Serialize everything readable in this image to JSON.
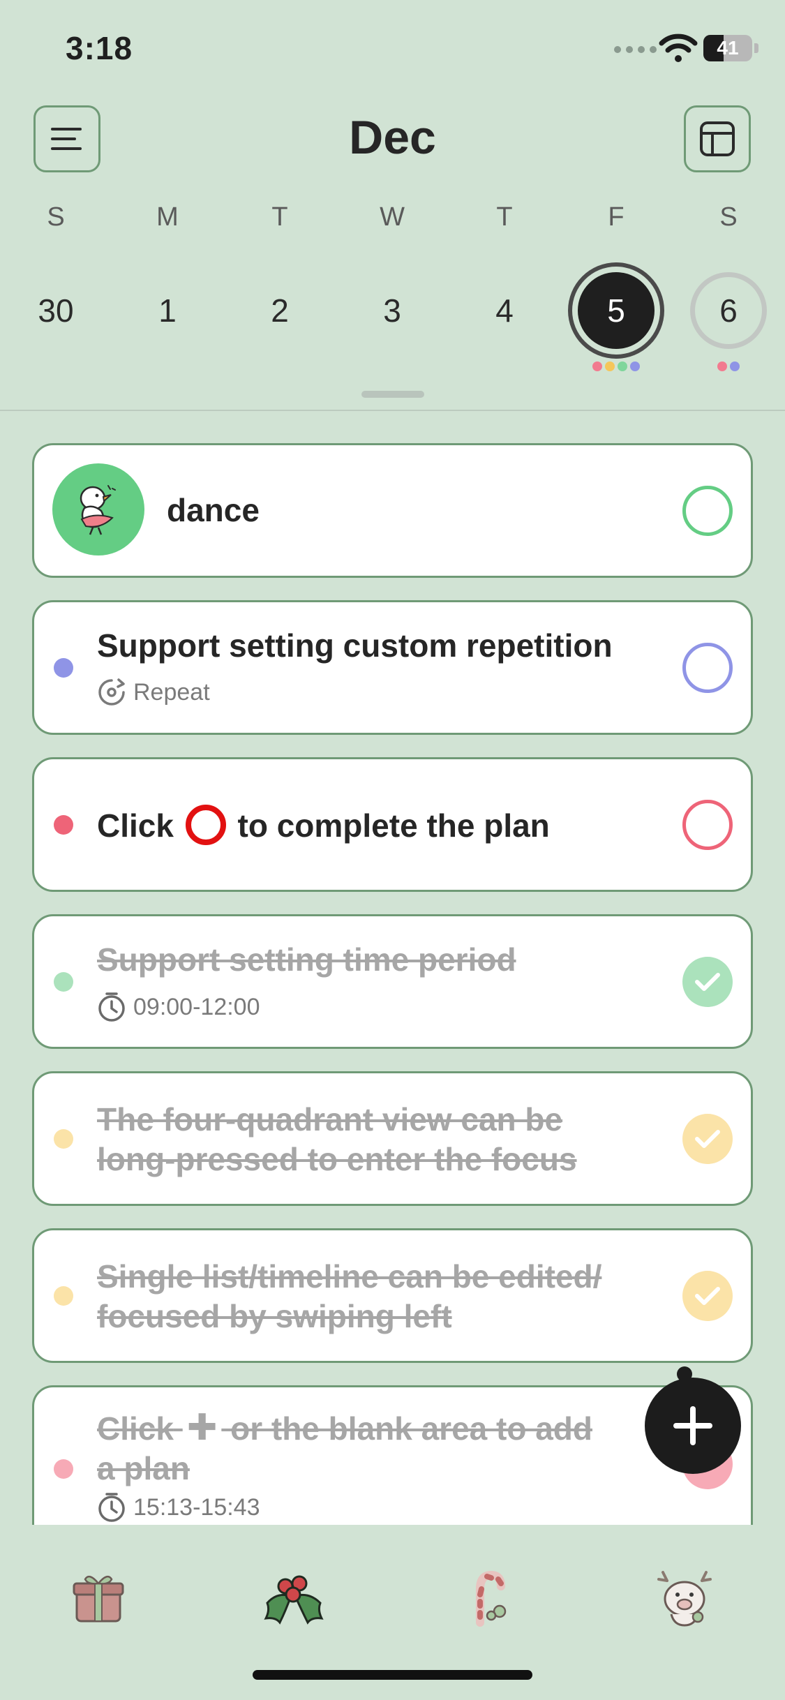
{
  "status_bar": {
    "time": "3:18",
    "battery_percent": "41",
    "battery_level": 0.41
  },
  "header": {
    "month": "Dec",
    "menu_icon": "hamburger-menu-icon",
    "layout_icon": "layout-grid-icon"
  },
  "week": {
    "weekdays": [
      "S",
      "M",
      "T",
      "W",
      "T",
      "F",
      "S"
    ],
    "dates": [
      "30",
      "1",
      "2",
      "3",
      "4",
      "5",
      "6"
    ],
    "today_index": 5,
    "friday_dots": [
      "#f27b8f",
      "#f5c65a",
      "#7fd69b",
      "#8f94e6"
    ],
    "saturday_dots": [
      "#f27b8f",
      "#8f94e6"
    ]
  },
  "tasks": [
    {
      "title": "dance",
      "completed": false,
      "color": "#64cd84",
      "avatar": "duck-dancing-sticker"
    },
    {
      "title": "Support setting custom repetition",
      "subtitle": "Repeat",
      "sub_icon": "repeat-icon",
      "completed": false,
      "color": "#8f94e6"
    },
    {
      "title_before": "Click",
      "title_after": "to complete the plan",
      "completed": false,
      "color": "#ee6478"
    },
    {
      "title": "Support setting time period",
      "subtitle": "09:00-12:00",
      "sub_icon": "clock-icon",
      "completed": true,
      "color": "#abe2bc"
    },
    {
      "title_line1": "The four-quadrant view can be",
      "title_line2": "long-pressed to enter the focus",
      "completed": true,
      "color": "#fbe3a8"
    },
    {
      "title_line1": "Single list/timeline can be edited/",
      "title_line2": "focused by swiping left",
      "completed": true,
      "color": "#fbe3a8"
    },
    {
      "title_before": "Click",
      "title_after": "or the blank area to add",
      "title_line2": "a plan",
      "subtitle": "15:13-15:43",
      "sub_icon": "clock-icon",
      "completed": true,
      "color": "#f7aab6"
    }
  ],
  "fab": {
    "icon": "plus-icon"
  },
  "tabs": [
    {
      "icon": "gift-box-icon",
      "active": false
    },
    {
      "icon": "holly-berries-icon",
      "active": true
    },
    {
      "icon": "candy-cane-icon",
      "active": false
    },
    {
      "icon": "reindeer-pig-icon",
      "active": false
    }
  ]
}
